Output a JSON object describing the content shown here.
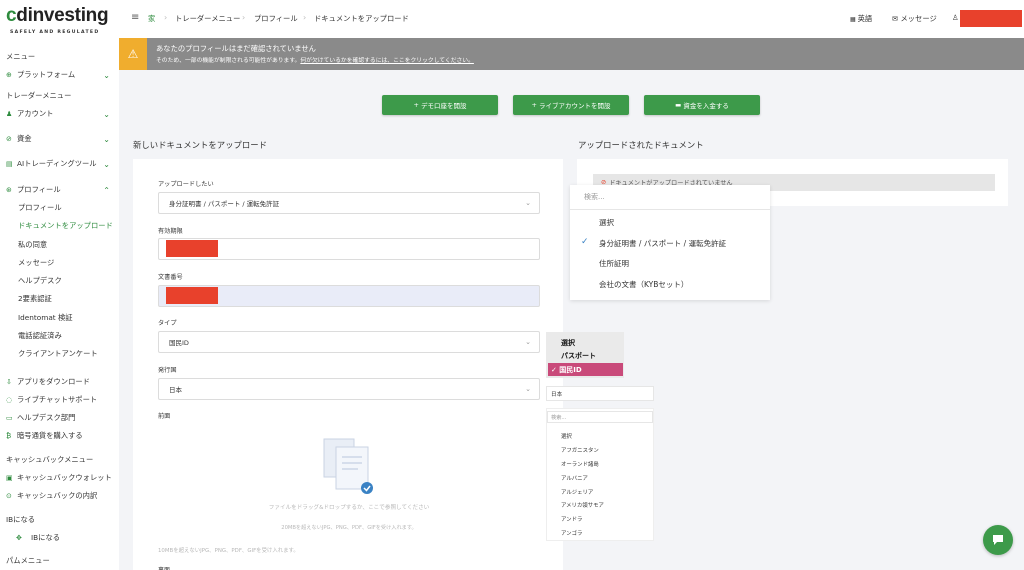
{
  "brand": {
    "logo_text": "cdinvesting",
    "tagline": "SAFELY AND REGULATED"
  },
  "sidebar": {
    "menu_title": "メニュー",
    "platform": "プラットフォーム",
    "trader_menu_title": "トレーダーメニュー",
    "account": "アカウント",
    "funds": "資金",
    "ai_tools": "AIトレーディングツール",
    "profile": "プロフィール",
    "profile_sub": [
      "プロフィール",
      "ドキュメントをアップロード",
      "私の同意",
      "メッセージ",
      "ヘルプデスク",
      "2要素認証",
      "Identomat 検証",
      "電話認証済み",
      "クライアントアンケート"
    ],
    "download_app": "アプリをダウンロード",
    "live_chat": "ライブチャットサポート",
    "helpdesk_dept": "ヘルプデスク部門",
    "buy_crypto": "暗号通貨を購入する",
    "cashback_title": "キャッシュバックメニュー",
    "cashback_wallet": "キャッシュバックウォレット",
    "cashback_details": "キャッシュバックの内訳",
    "ib_title": "IBになる",
    "ib_item": "IBになる",
    "pamm_title": "パムメニュー"
  },
  "topbar": {
    "breadcrumb": [
      "家",
      "トレーダーメニュー",
      "プロフィール",
      "ドキュメントをアップロード"
    ],
    "language": "英語",
    "messages": "メッセージ"
  },
  "warning": {
    "title": "あなたのプロフィールはまだ確認されていません",
    "subtitle": "そのため、一部の機能が制限される可能性があります。",
    "link": "何が欠けているかを確認するには、ここをクリックしてください。"
  },
  "actions": {
    "demo": "デモ口座を開設",
    "live": "ライブアカウントを開設",
    "deposit": "資金を入金する"
  },
  "upload_form": {
    "title": "新しいドキュメントをアップロード",
    "doc_type_label": "アップロードしたい",
    "doc_type_value": "身分証明書 / パスポート / 運転免許証",
    "expiry_label": "有効期限",
    "doc_number_label": "文書番号",
    "type_label": "タイプ",
    "type_value": "国民ID",
    "country_label": "発行国",
    "country_value": "日本",
    "front_label": "前面",
    "dropzone_text": "ファイルをドラッグ&ドロップするか、ここで参照してください",
    "dropzone_formats": "20MBを超えないJPG、PNG、PDF、GIFを受け入れます。",
    "note": "10MBを超えないJPG、PNG、PDF、GIFを受け入れます。",
    "back_label": "裏面"
  },
  "uploaded": {
    "title": "アップロードされたドキュメント",
    "empty": "ドキュメントがアップロードされていません"
  },
  "doc_type_dropdown": {
    "search_placeholder": "検索...",
    "options": [
      "選択",
      "身分証明書 / パスポート / 運転免許証",
      "住所証明",
      "会社の文書（KYBセット）"
    ]
  },
  "type_dropdown": {
    "options": [
      "選択",
      "パスポート"
    ],
    "selected": "✓ 国民ID"
  },
  "country_dropdown": {
    "value": "日本",
    "search_placeholder": "検索...",
    "options": [
      "選択",
      "アフガニスタン",
      "オーランド諸島",
      "アルバニア",
      "アルジェリア",
      "アメリカ領サモア",
      "アンドラ",
      "アンゴラ"
    ]
  }
}
